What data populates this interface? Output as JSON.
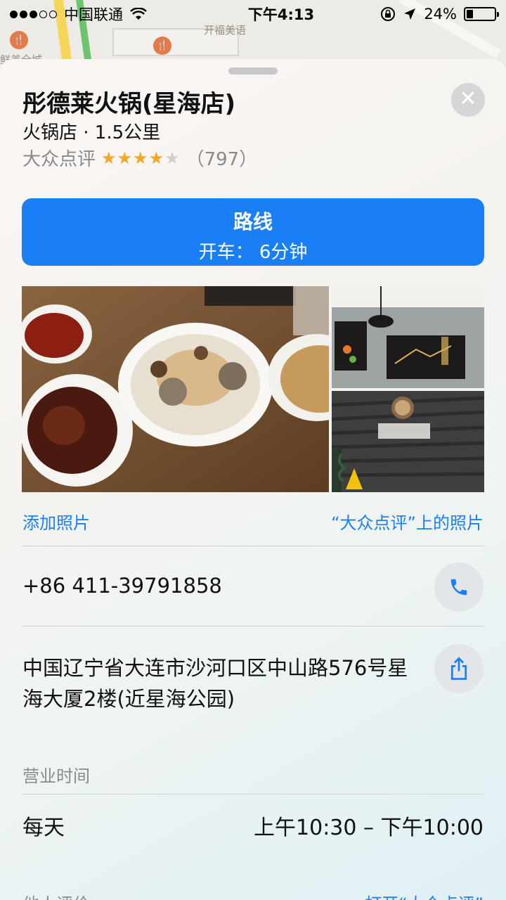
{
  "status_bar": {
    "carrier": "中国联通",
    "time": "下午4:13",
    "battery": "24%",
    "battery_level": 0.24,
    "signal_bars_filled": 3,
    "signal_bars_total": 5
  },
  "map": {
    "label_top": "开福美语",
    "label_left": "鲜美全城"
  },
  "place": {
    "name": "彤德莱火锅(星海店)",
    "subtitle": "火锅店 · 1.5公里",
    "rating_source": "大众点评",
    "stars": 4,
    "stars_max": 5,
    "stars_display": "★★★★★",
    "review_count": "（797）"
  },
  "route": {
    "label": "路线",
    "detail": "开车：  6分钟"
  },
  "photos": {
    "add_label": "添加照片",
    "source_label": "“大众点评”上的照片"
  },
  "contact": {
    "phone": "+86 411-39791858",
    "address": "中国辽宁省大连市沙河口区中山路576号星海大厦2楼(近星海公园)"
  },
  "hours": {
    "label": "营业时间",
    "day": "每天",
    "time": "上午10:30 – 下午10:00"
  },
  "footer": {
    "left": "他人评价",
    "right": "打开“大众点评”"
  },
  "colors": {
    "accent": "#1a7ef5",
    "star": "#f5a623"
  },
  "icons": {
    "close": "close-icon",
    "phone": "phone-icon",
    "share": "share-icon",
    "wifi": "wifi-icon",
    "location": "location-arrow-icon",
    "lock": "rotation-lock-icon"
  }
}
